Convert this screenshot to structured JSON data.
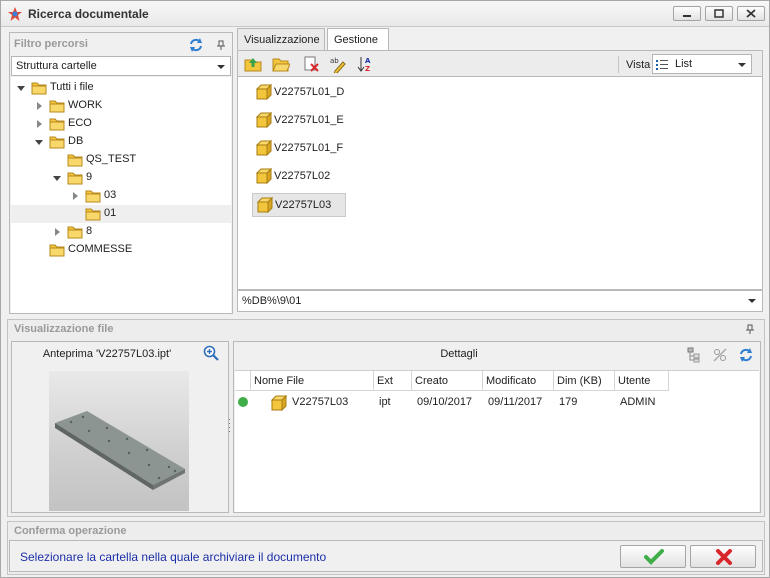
{
  "window": {
    "title": "Ricerca documentale"
  },
  "filter_panel": {
    "title": "Filtro percorsi",
    "structure_combo": "Struttura cartelle",
    "tree": [
      {
        "label": "Tutti i file",
        "level": 0,
        "expanded": true
      },
      {
        "label": "WORK",
        "level": 1,
        "expanded": false
      },
      {
        "label": "ECO",
        "level": 1,
        "expanded": false
      },
      {
        "label": "DB",
        "level": 1,
        "expanded": true
      },
      {
        "label": "QS_TEST",
        "level": 2,
        "expanded": null
      },
      {
        "label": "9",
        "level": 2,
        "expanded": true
      },
      {
        "label": "03",
        "level": 3,
        "expanded": false
      },
      {
        "label": "01",
        "level": 3,
        "expanded": null,
        "selected": true
      },
      {
        "label": "8",
        "level": 2,
        "expanded": false
      },
      {
        "label": "COMMESSE",
        "level": 1,
        "expanded": null
      }
    ]
  },
  "tabs": [
    {
      "label": "Visualizzazione",
      "active": false
    },
    {
      "label": "Gestione",
      "active": true
    }
  ],
  "toolbar": {
    "view_label": "Vista",
    "view_value": "List"
  },
  "files": [
    {
      "name": "V22757L01_D",
      "selected": false
    },
    {
      "name": "V22757L01_E",
      "selected": false
    },
    {
      "name": "V22757L01_F",
      "selected": false
    },
    {
      "name": "V22757L02",
      "selected": false
    },
    {
      "name": "V22757L03",
      "selected": true
    }
  ],
  "path": "%DB%\\9\\01",
  "file_view": {
    "title": "Visualizzazione file",
    "preview_caption": "Anteprima 'V22757L03.ipt'",
    "details_title": "Dettagli",
    "columns": [
      "Nome File",
      "Ext",
      "Creato",
      "Modificato",
      "Dim (KB)",
      "Utente"
    ],
    "row": {
      "name": "V22757L03",
      "ext": "ipt",
      "created": "09/10/2017",
      "modified": "09/11/2017",
      "size": "179",
      "user": "ADMIN",
      "status_color": "#3fae49"
    }
  },
  "confirm": {
    "title": "Conferma operazione",
    "message": "Selezionare la cartella nella quale archiviare il documento"
  },
  "colors": {
    "accent_blue": "#1b2fa8",
    "ok_green": "#3fae49",
    "cancel_red": "#d8262b",
    "folder_yellow": "#f2c53d"
  }
}
